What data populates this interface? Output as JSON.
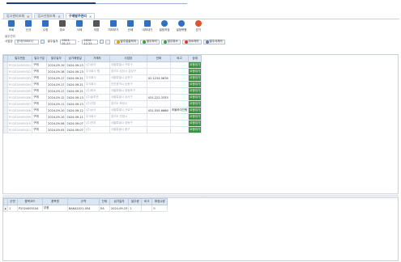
{
  "tabs": [
    {
      "label": "입고관리조회",
      "active": false
    },
    {
      "label": "입고신청조회",
      "active": false
    },
    {
      "label": "구매발주관리",
      "active": true
    }
  ],
  "toolbar": [
    {
      "label": "조회",
      "icon": "search-icon",
      "color": "#2f6fc6"
    },
    {
      "label": "신규",
      "icon": "new-doc-icon",
      "color": "#2f6fc6"
    },
    {
      "label": "수정",
      "icon": "edit-icon",
      "color": "#2f6fc6"
    },
    {
      "label": "취소",
      "icon": "undo-icon",
      "color": "#555555"
    },
    {
      "label": "삭제",
      "icon": "trash-icon",
      "color": "#2f6fc6"
    },
    {
      "label": "저장",
      "icon": "save-icon",
      "color": "#555555"
    },
    {
      "label": "미리보기",
      "icon": "preview-icon",
      "color": "#2f6fc6"
    },
    {
      "label": "인쇄",
      "icon": "print-icon",
      "color": "#2f6fc6"
    },
    {
      "label": "내보내기",
      "icon": "export-icon",
      "color": "#2f6fc6"
    },
    {
      "label": "설정저장",
      "icon": "gear-icon",
      "color": "#2f6fc6"
    },
    {
      "label": "설정복원",
      "icon": "gear-restore-icon",
      "color": "#2f6fc6"
    },
    {
      "label": "닫기",
      "icon": "close-icon",
      "color": "#e0522b"
    }
  ],
  "sublabel": "발주관리",
  "filter": {
    "type_label": "사업장",
    "type_value": "본사(00001)",
    "date_label": "발주일자",
    "date_from": "2024-01-27",
    "date_to": "2024-12-31",
    "buttons": [
      {
        "label": "발주일괄처리",
        "color": "#d9a400"
      },
      {
        "label": "발주처리",
        "color": "#3a9b3a"
      },
      {
        "label": "발주취소",
        "color": "#3a9b3a"
      },
      {
        "label": "취소처리",
        "color": "#d93a2b"
      },
      {
        "label": "발주서처리",
        "color": "#5a7bb5"
      }
    ]
  },
  "grid1": {
    "headers": [
      "발주번호",
      "발주구분",
      "발주일자",
      "납기예정일",
      "거래처",
      "사업장",
      "전화",
      "비고",
      "상태"
    ],
    "rows": [
      [
        "PO2024000001",
        "구매",
        "2024-09-19",
        "2024-09-23",
        "(주)상사",
        "서울특별시 구로구",
        "",
        "",
        "요청대기"
      ],
      [
        "PO2024000002",
        "구매",
        "2024-09-18",
        "2024-09-23",
        "주식회사 원",
        "경기도 성남시 분당구",
        "",
        "",
        "요청대기"
      ],
      [
        "PO2024000003",
        "구매",
        "2024-09-17",
        "2024-09-21",
        "주식회사",
        "서울특별시 금천구",
        "02-1234-5678",
        "",
        "요청대기"
      ],
      [
        "PO2024000004",
        "구매",
        "2024-09-17",
        "2024-09-21",
        "주식회사",
        "인천광역시 남동구",
        "",
        "",
        "요청대기"
      ],
      [
        "PO2024000005",
        "구매",
        "2024-09-17",
        "2024-09-21",
        "(주)테크",
        "서울특별시 영등포구",
        "",
        "",
        "요청대기"
      ],
      [
        "PO2024000006",
        "구매",
        "2024-09-12",
        "2024-09-13",
        "(주)솔루션",
        "서울특별시 강서구",
        "031-222-3333",
        "",
        "요청대기"
      ],
      [
        "PO2024000007",
        "구매",
        "2024-09-11",
        "2024-09-13",
        "(주)산업",
        "경기도 화성시",
        "",
        "",
        "요청대기"
      ],
      [
        "PO2024000008",
        "구매",
        "2024-09-10",
        "2024-09-12",
        "(주)상사",
        "서울특별시 구로구",
        "031-555-6666",
        "조율하여진행",
        "요청대기"
      ],
      [
        "PO2024000009",
        "구매",
        "2024-09-10",
        "2024-09-11",
        "주식회사",
        "경기도 안양시",
        "",
        "",
        "요청대기"
      ],
      [
        "PO2024000010",
        "구매",
        "2024-09-06",
        "2024-09-07",
        "(주)전자",
        "서울특별시 성동구",
        "",
        "",
        "요청대기"
      ],
      [
        "PO2024000011",
        "구매",
        "2024-09-05",
        "2024-09-07",
        "(주)",
        "서울특별시 중구",
        "",
        "",
        "요청대기"
      ]
    ]
  },
  "grid2": {
    "headers": [
      "순번",
      "품목코드",
      "품목명",
      "규격",
      "단위",
      "납기일자",
      "발주량",
      "비고",
      "확정수량"
    ],
    "rows": [
      [
        "1",
        "P2024000104",
        "부품",
        "BAKA2021-004",
        "EA",
        "2024-09-23",
        "1",
        "",
        "0"
      ]
    ]
  }
}
